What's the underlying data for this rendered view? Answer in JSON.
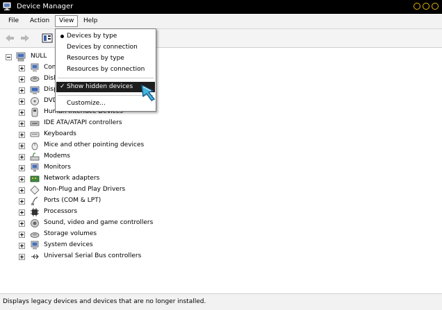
{
  "window": {
    "title": "Device Manager"
  },
  "menu": [
    {
      "label": "File"
    },
    {
      "label": "Action"
    },
    {
      "label": "View"
    },
    {
      "label": "Help"
    }
  ],
  "view_menu": {
    "items": [
      {
        "label": "Devices by type",
        "marker": "bullet"
      },
      {
        "label": "Devices by connection"
      },
      {
        "label": "Resources by type"
      },
      {
        "label": "Resources by connection"
      },
      {
        "label": "Show hidden devices",
        "marker": "check",
        "highlighted": true
      },
      {
        "label": "Customize..."
      }
    ]
  },
  "tree": {
    "root": "NULL",
    "items": [
      {
        "label": "Computer",
        "icon": "computer-icon"
      },
      {
        "label": "Disk drives",
        "icon": "disk-drive-icon"
      },
      {
        "label": "Display adapters",
        "icon": "display-adapter-icon"
      },
      {
        "label": "DVD/CD-ROM drives",
        "icon": "dvd-drive-icon"
      },
      {
        "label": "Human Interface Devices",
        "icon": "hid-icon"
      },
      {
        "label": "IDE ATA/ATAPI controllers",
        "icon": "ide-controller-icon"
      },
      {
        "label": "Keyboards",
        "icon": "keyboard-icon"
      },
      {
        "label": "Mice and other pointing devices",
        "icon": "mouse-icon"
      },
      {
        "label": "Modems",
        "icon": "modem-icon"
      },
      {
        "label": "Monitors",
        "icon": "monitor-icon"
      },
      {
        "label": "Network adapters",
        "icon": "network-adapter-icon"
      },
      {
        "label": "Non-Plug and Play Drivers",
        "icon": "driver-icon"
      },
      {
        "label": "Ports (COM & LPT)",
        "icon": "port-icon"
      },
      {
        "label": "Processors",
        "icon": "processor-icon"
      },
      {
        "label": "Sound, video and game controllers",
        "icon": "sound-icon"
      },
      {
        "label": "Storage volumes",
        "icon": "storage-volume-icon"
      },
      {
        "label": "System devices",
        "icon": "system-device-icon"
      },
      {
        "label": "Universal Serial Bus controllers",
        "icon": "usb-icon"
      }
    ]
  },
  "status": {
    "text": "Displays legacy devices and devices that are no longer installed."
  },
  "colors": {
    "titlebar": "#000000",
    "highlight": "#1e1e1e",
    "window_control": "#e8b800"
  }
}
